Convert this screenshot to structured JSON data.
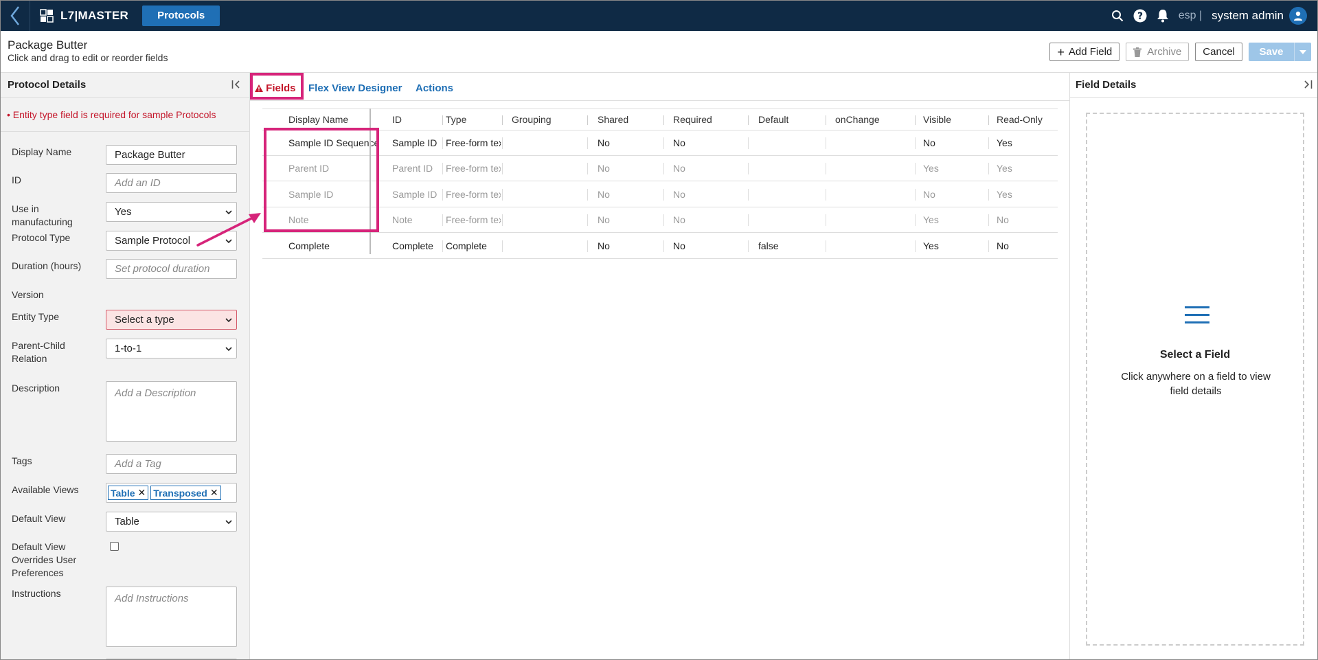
{
  "topbar": {
    "app_name": "L7|MASTER",
    "active_tab": "Protocols",
    "tenant": "esp |",
    "user_name": "system admin"
  },
  "header": {
    "title": "Package Butter",
    "subtitle": "Click and drag to edit or reorder fields",
    "add_field": "Add Field",
    "archive": "Archive",
    "cancel": "Cancel",
    "save": "Save"
  },
  "left_panel": {
    "title": "Protocol Details",
    "error": "• Entity type field is required for sample Protocols",
    "fields": {
      "display_name": {
        "label": "Display Name",
        "value": "Package Butter"
      },
      "id": {
        "label": "ID",
        "placeholder": "Add an ID"
      },
      "use_in_manufacturing": {
        "label": "Use in manufacturing",
        "value": "Yes"
      },
      "protocol_type": {
        "label": "Protocol Type",
        "value": "Sample Protocol"
      },
      "duration": {
        "label": "Duration (hours)",
        "placeholder": "Set protocol duration"
      },
      "version": {
        "label": "Version"
      },
      "entity_type": {
        "label": "Entity Type",
        "value": "Select a type"
      },
      "parent_child": {
        "label": "Parent-Child Relation",
        "value": "1-to-1"
      },
      "description": {
        "label": "Description",
        "placeholder": "Add a Description"
      },
      "tags": {
        "label": "Tags",
        "placeholder": "Add a Tag"
      },
      "available_views": {
        "label": "Available Views",
        "chips": [
          "Table",
          "Transposed"
        ]
      },
      "default_view": {
        "label": "Default View",
        "value": "Table"
      },
      "default_view_overrides": {
        "label": "Default View Overrides User Preferences",
        "checked": false
      },
      "instructions": {
        "label": "Instructions",
        "placeholder": "Add Instructions"
      }
    }
  },
  "center": {
    "tabs": [
      "Fields",
      "Flex View Designer",
      "Actions"
    ],
    "columns": [
      "Display Name",
      "ID",
      "Type",
      "Grouping",
      "Shared",
      "Required",
      "Default",
      "onChange",
      "Visible",
      "Read-Only"
    ],
    "rows": [
      {
        "display_name": "Sample ID Sequence",
        "id": "Sample ID",
        "type": "Free-form tex",
        "grouping": "",
        "shared": "No",
        "required": "No",
        "default": "",
        "onchange": "",
        "visible": "No",
        "readonly": "Yes"
      },
      {
        "display_name": "Parent ID",
        "id": "Parent ID",
        "type": "Free-form tex",
        "grouping": "",
        "shared": "No",
        "required": "No",
        "default": "",
        "onchange": "",
        "visible": "Yes",
        "readonly": "Yes"
      },
      {
        "display_name": "Sample ID",
        "id": "Sample ID",
        "type": "Free-form tex",
        "grouping": "",
        "shared": "No",
        "required": "No",
        "default": "",
        "onchange": "",
        "visible": "No",
        "readonly": "Yes"
      },
      {
        "display_name": "Note",
        "id": "Note",
        "type": "Free-form tex",
        "grouping": "",
        "shared": "No",
        "required": "No",
        "default": "",
        "onchange": "",
        "visible": "Yes",
        "readonly": "No"
      },
      {
        "display_name": "Complete",
        "id": "Complete",
        "type": "Complete",
        "grouping": "",
        "shared": "No",
        "required": "No",
        "default": "false",
        "onchange": "",
        "visible": "Yes",
        "readonly": "No"
      }
    ]
  },
  "right_panel": {
    "title": "Field Details",
    "empty_title": "Select a Field",
    "empty_desc": "Click anywhere on a field to view field details"
  },
  "colors": {
    "topbar": "#0f2a45",
    "accent": "#1f6fb5",
    "error": "#c4162a",
    "annotation": "#d6247a"
  }
}
